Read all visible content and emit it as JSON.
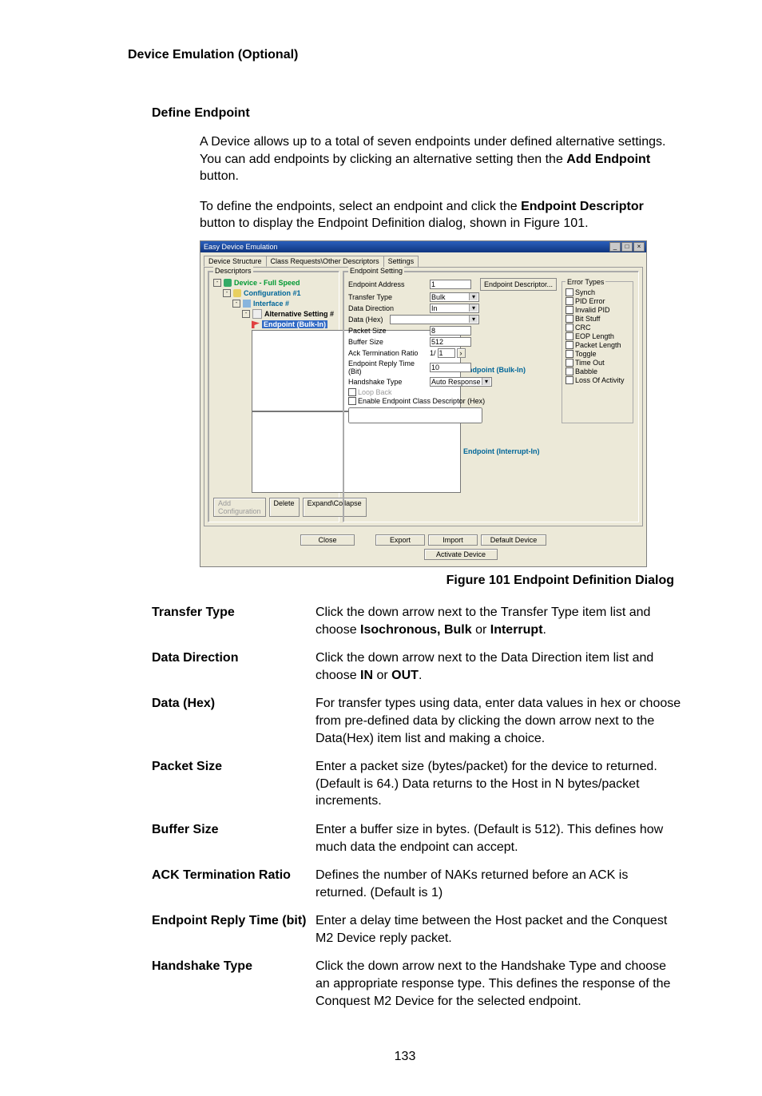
{
  "section_header": "Device Emulation (Optional)",
  "subhead": "Define Endpoint",
  "para1_a": "A Device allows up to a total of seven endpoints under defined alternative settings. You can add endpoints by clicking an alternative setting then the ",
  "para1_b": "Add Endpoint",
  "para1_c": " button.",
  "para2_a": "To define the endpoints, select an endpoint and click the ",
  "para2_b": "Endpoint Descriptor",
  "para2_c": " button to display the Endpoint Definition dialog, shown in Figure 101.",
  "dialog": {
    "title": "Easy Device Emulation",
    "tabs": [
      "Device Structure",
      "Class Requests\\Other Descriptors",
      "Settings"
    ],
    "descriptors_group": "Descriptors",
    "tree": {
      "device": "Device - Full Speed",
      "config": "Configuration #1",
      "iface": "Interface #",
      "alt": "Alternative Setting #",
      "ep1": "Endpoint (Bulk-In)",
      "ep2": "Endpoint (Bulk-In)",
      "ep3": "Endpoint (Interrupt-In)"
    },
    "btn_addcfg": "Add Configuration",
    "btn_delete": "Delete",
    "btn_expand": "Expand\\Collapse",
    "eps_group": "Endpoint Setting",
    "ep_addr": "Endpoint Address",
    "ep_addr_v": "1",
    "tt": "Transfer Type",
    "tt_v": "Bulk",
    "dd": "Data Direction",
    "dd_v": "In",
    "dh": "Data (Hex)",
    "ps": "Packet Size",
    "ps_v": "8",
    "bs": "Buffer Size",
    "bs_v": "512",
    "atr": "Ack Termination Ratio",
    "atr_v1": "1/",
    "atr_v2": "1",
    "ert": "Endpoint Reply Time (Bit)",
    "ert_v": "10",
    "ht": "Handshake Type",
    "ht_v": "Auto Response",
    "lb": "Loop Back",
    "ecdh": "Enable Endpoint Class Descriptor (Hex)",
    "epdesc": "Endpoint Descriptor...",
    "err_group": "Error Types",
    "errs": [
      "Synch",
      "PID Error",
      "Invalid PID",
      "Bit Stuff",
      "CRC",
      "EOP Length",
      "Packet Length",
      "Toggle",
      "Time Out",
      "Babble",
      "Loss Of Activity"
    ],
    "close": "Close",
    "export": "Export",
    "import": "Import",
    "defdev": "Default Device",
    "activate": "Activate Device"
  },
  "figure_caption": "Figure  101  Endpoint Definition Dialog",
  "defs": [
    {
      "term": "Transfer Type",
      "d1": "Click the down arrow next to the Transfer Type item list and choose ",
      "d2": "Isochronous, Bulk",
      "d3": " or ",
      "d4": "Interrupt",
      "d5": "."
    },
    {
      "term": "Data Direction",
      "d1": "Click the down arrow next to the Data Direction item list and choose ",
      "d2": "IN",
      "d3": " or ",
      "d4": "OUT",
      "d5": "."
    },
    {
      "term": "Data (Hex)",
      "d1": "For transfer types using data, enter data values in hex or choose from pre-defined data by clicking the down arrow next to the Data(Hex) item list and making a choice."
    },
    {
      "term": "Packet Size",
      "d1": "Enter a packet size (bytes/packet) for the device to returned. (Default is 64.) Data returns to the Host in N bytes/packet increments."
    },
    {
      "term": "Buffer Size",
      "d1": "Enter a buffer size in bytes. (Default is 512). This defines how much data the endpoint can accept."
    },
    {
      "term": "ACK Termination Ratio",
      "d1": "Defines the number of NAKs returned before an ACK is returned. (Default is 1)"
    },
    {
      "term": "Endpoint Reply Time (bit)",
      "d1": "Enter a delay time between the Host packet and the Conquest M2 Device reply packet."
    },
    {
      "term": "Handshake Type",
      "d1": "Click the down arrow next to the Handshake Type and choose an appropriate response type. This defines the response of the Conquest M2 Device for the selected endpoint."
    }
  ],
  "page_number": "133"
}
